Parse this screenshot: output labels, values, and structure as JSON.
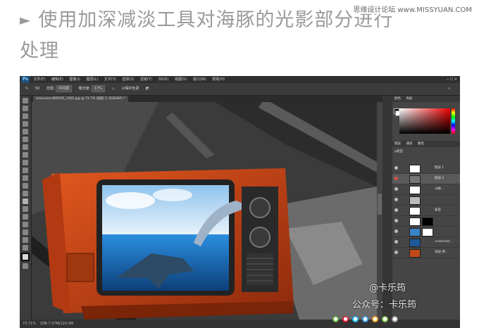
{
  "article": {
    "heading_icon": "play-triangle-icon",
    "heading_line1": "使用加深减淡工具对海豚的光影部分进行",
    "heading_line2": "处理",
    "site_watermark": "思缘设计论坛 www.MISSYUAN.COM"
  },
  "ps": {
    "logo": "Ps",
    "menu": [
      "文件(F)",
      "编辑(E)",
      "图像(I)",
      "图层(L)",
      "文字(Y)",
      "选择(S)",
      "滤镜(T)",
      "3D(D)",
      "视图(V)",
      "窗口(W)",
      "帮助(H)"
    ],
    "options": {
      "size": "50",
      "range_label": "范围:",
      "range_value": "中间调",
      "exposure_label": "曝光度:",
      "exposure_value": "17%",
      "protect_label": "保护色调"
    },
    "doc_tab": "television-899265_1920.jpg @ 73.7% (图层 2, RGB/8#) *",
    "status_zoom": "73.71%",
    "status_doc": "文档:7.37M/120.0M",
    "panel_tabs": [
      "颜色",
      "色板"
    ],
    "layers_tabs": [
      "图层",
      "通道",
      "路径"
    ],
    "layers_filter": "ρ类型",
    "layers": [
      {
        "name": "图层 1",
        "selected": false
      },
      {
        "name": "图层 2",
        "selected": true
      },
      {
        "name": "山脉...",
        "selected": false
      },
      {
        "name": "",
        "selected": false
      },
      {
        "name": "鲨鱼",
        "selected": false
      },
      {
        "name": "",
        "selected": false
      },
      {
        "name": "",
        "selected": false
      },
      {
        "name": "underwat...",
        "selected": false
      },
      {
        "name": "电视 拷...",
        "selected": false
      }
    ]
  },
  "footer": {
    "at_name": "@卡乐筠",
    "wechat": "公众号：卡乐筠",
    "icons": [
      "wechat-icon",
      "weibo-icon",
      "qq-icon",
      "mic-icon",
      "like-icon",
      "share-icon",
      "menu-icon"
    ]
  },
  "colors": {
    "tv_orange": "#c8441a",
    "water_blue": "#1b74c4",
    "ps_dark": "#3a3a3a"
  }
}
